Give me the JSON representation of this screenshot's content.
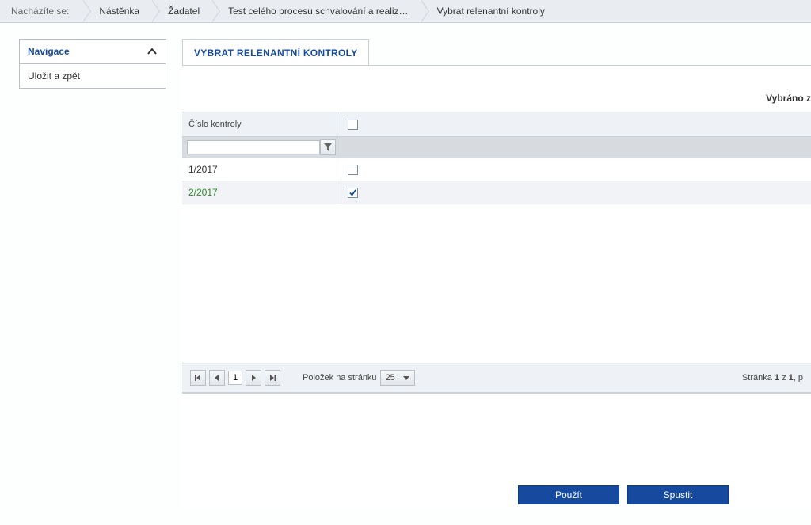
{
  "breadcrumb": {
    "label": "Nacházíte se:",
    "items": [
      "Nástěnka",
      "Žadatel",
      "Test celého procesu schvalování a realiz…",
      "Vybrat relenantní kontroly"
    ]
  },
  "sidebar": {
    "header": "Navigace",
    "items": [
      "Uložit a zpět"
    ]
  },
  "tab": {
    "title": "VYBRAT RELENANTNÍ KONTROLY"
  },
  "summary": {
    "label": "Vybráno z"
  },
  "grid": {
    "columns": [
      "Číslo kontroly",
      ""
    ],
    "filter_value": "",
    "rows": [
      {
        "num": "1/2017",
        "checked": false
      },
      {
        "num": "2/2017",
        "checked": true
      }
    ]
  },
  "pager": {
    "page": "1",
    "items_per_page_label": "Položek na stránku",
    "page_size": "25",
    "status_prefix": "Stránka ",
    "status_page": "1",
    "status_mid": " z ",
    "status_total": "1",
    "status_suffix": ", p"
  },
  "actions": {
    "use": "Použít",
    "run": "Spustit"
  }
}
